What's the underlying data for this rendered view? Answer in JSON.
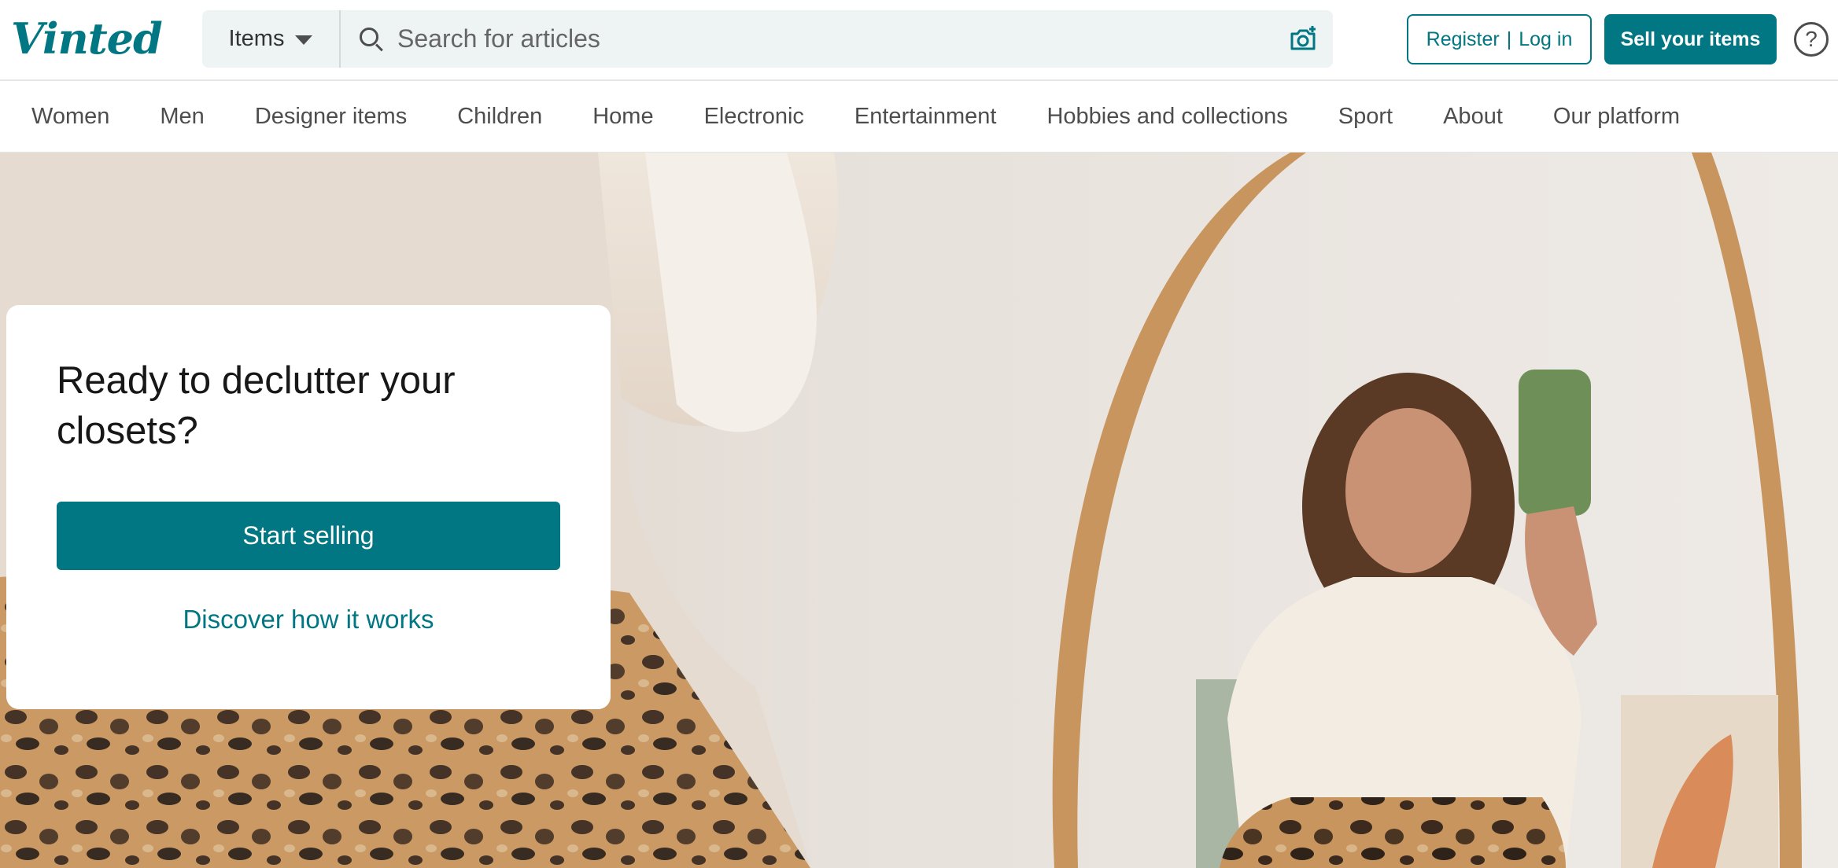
{
  "brand": {
    "logo_text": "Vinted",
    "color": "#007782"
  },
  "search": {
    "category_label": "Items",
    "placeholder": "Search for articles",
    "value": "",
    "icons": [
      "search-icon",
      "camera-icon",
      "chevron-down-icon"
    ]
  },
  "header": {
    "register_label": "Register",
    "separator": "|",
    "login_label": "Log in",
    "sell_label": "Sell your items",
    "help_label": "?"
  },
  "nav": {
    "items": [
      "Women",
      "Men",
      "Designer items",
      "Children",
      "Home",
      "Electronic",
      "Entertainment",
      "Hobbies and collections",
      "Sport",
      "About",
      "Our platform"
    ]
  },
  "hero": {
    "title": "Ready to declutter your closets?",
    "primary_label": "Start selling",
    "secondary_label": "Discover how it works"
  }
}
